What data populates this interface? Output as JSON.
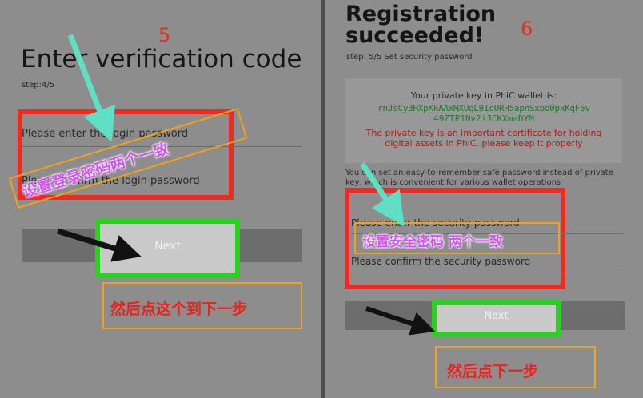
{
  "left": {
    "step_number": "5",
    "title": "Enter verification code",
    "step": "step:4/5",
    "login_password_placeholder": "Please enter the login password",
    "confirm_password_placeholder": "Please confirm the login password",
    "next_label": "Next",
    "annotation_passwords": "设置登录密码两个一致",
    "annotation_next": "然后点这个到下一步"
  },
  "right": {
    "step_number": "6",
    "title_line1": "Registration",
    "title_line2": "succeeded!",
    "step": "step: 5/5 Set security password",
    "key_heading": "Your private key in PhiC wallet is:",
    "key_line1": "rnJsCy3HXpKkAAxMXUqL9IcORH5apnSxpo0pxKqF5v",
    "key_line2": "49ZTP1Nv2iJCKXmaDYM",
    "key_note_line1": "The private key is an important certificate for holding",
    "key_note_line2": "digital assets in PhiC, please keep it properly",
    "info_line1": "You can set an easy-to-remember safe password instead of private",
    "info_line2": "key, which is convenient for various wallet operations",
    "security_password_placeholder": "Please enter the security password",
    "confirm_security_placeholder": "Please confirm the security password",
    "next_label": "Next",
    "annotation_passwords": "设置安全密码 两个一致",
    "annotation_next": "然后点下一步"
  },
  "colors": {
    "red_frame": "#ee2a24",
    "green_frame": "#27d31d",
    "orange_box": "#f0a21f",
    "pink_text": "#cf56ee",
    "teal_arrow": "#5fe0c4",
    "key_green": "#1c7a2e"
  }
}
